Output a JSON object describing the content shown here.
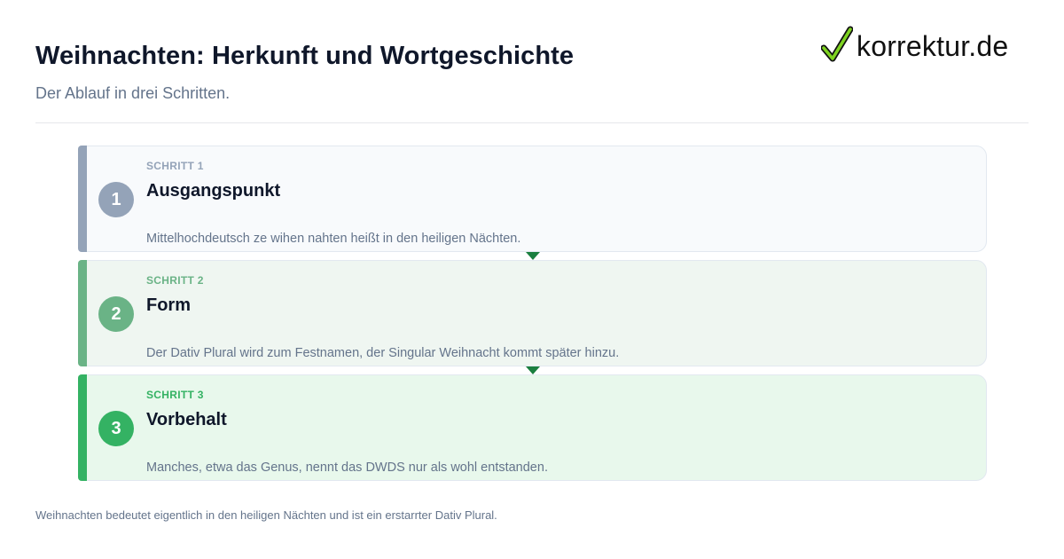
{
  "header": {
    "title": "Weihnachten: Herkunft und Wortgeschichte",
    "subtitle": "Der Ablauf in drei Schritten."
  },
  "logo": {
    "text": "korrektur.de",
    "icon": "checkmark-icon",
    "icon_color": "#7ed321"
  },
  "steps": [
    {
      "number": "1",
      "kicker": "SCHRITT 1",
      "heading": "Ausgangspunkt",
      "description": "Mittelhochdeutsch ze wihen nahten heißt in den heiligen Nächten.",
      "color": "#94a3b8"
    },
    {
      "number": "2",
      "kicker": "SCHRITT 2",
      "heading": "Form",
      "description": "Der Dativ Plural wird zum Festnamen, der Singular Weihnacht kommt später hinzu.",
      "color": "#6ab386"
    },
    {
      "number": "3",
      "kicker": "SCHRITT 3",
      "heading": "Vorbehalt",
      "description": "Manches, etwa das Genus, nennt das DWDS nur als wohl entstanden.",
      "color": "#34b263"
    }
  ],
  "connector_color": "#1a7f3f",
  "footer": {
    "note": "Weihnachten bedeutet eigentlich in den heiligen Nächten und ist ein erstarrter Dativ Plural."
  }
}
